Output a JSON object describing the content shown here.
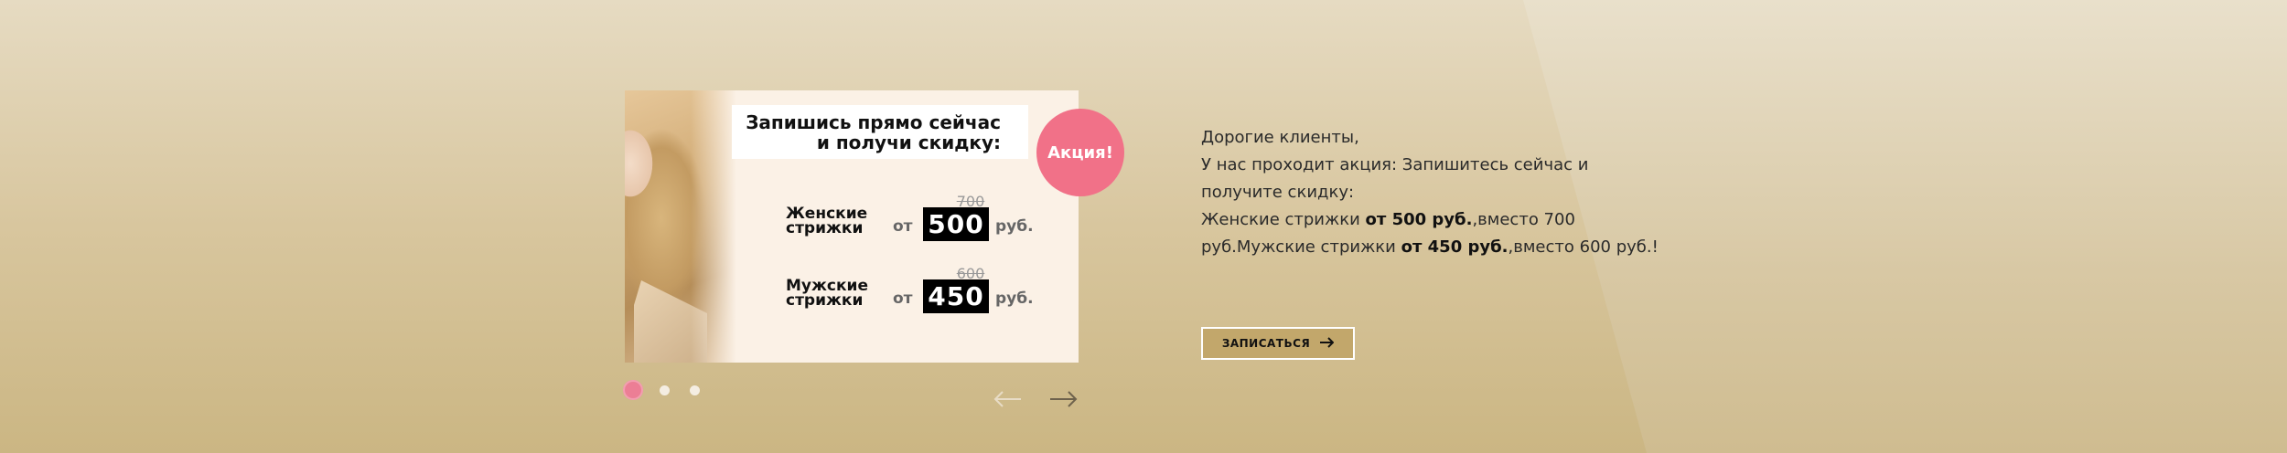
{
  "promo": {
    "title_line1": "Запишись прямо сейчас",
    "title_line2": "и получи скидку:",
    "badge": "Акция!",
    "rows": [
      {
        "label_line1": "Женские",
        "label_line2": "стрижки",
        "from": "от",
        "old_price": "700",
        "new_price": "500",
        "currency": "руб."
      },
      {
        "label_line1": "Мужские",
        "label_line2": "стрижки",
        "from": "от",
        "old_price": "600",
        "new_price": "450",
        "currency": "руб."
      }
    ]
  },
  "slider": {
    "active_index": 0,
    "slide_count": 3,
    "prev_icon": "arrow-left-icon",
    "next_icon": "arrow-right-icon"
  },
  "info": {
    "greeting": "Дорогие клиенты,",
    "line1": "У нас проходит акция: Запишитесь сейчас и",
    "line2": "получите скидку:",
    "line3_pre": "Женские стрижки ",
    "line3_bold": "от 500 руб.",
    "line3_post": ",вместо 700",
    "line4_pre": "руб.Мужские стрижки ",
    "line4_bold": "от 450 руб.",
    "line4_post": ",вместо 600 руб.!"
  },
  "cta": {
    "label": "ЗАПИСАТЬСЯ",
    "icon": "arrow-right-icon"
  },
  "colors": {
    "badge": "#f17188",
    "cta_bg": "#c2a76b",
    "active_dot": "#ec7e95"
  }
}
